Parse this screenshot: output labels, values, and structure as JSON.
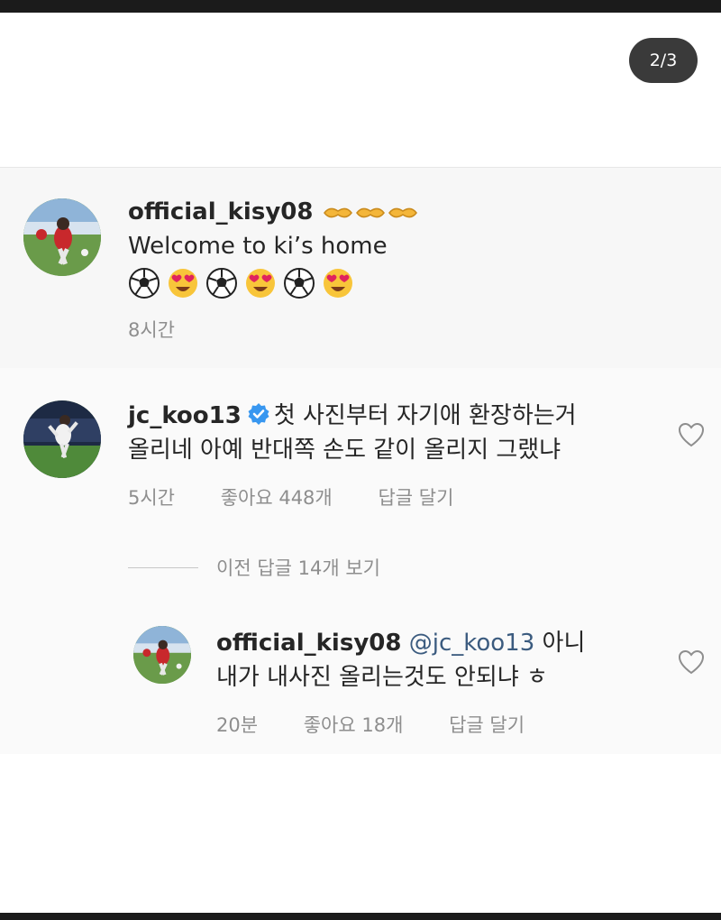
{
  "page_indicator": "2/3",
  "caption": {
    "username": "official_kisy08",
    "emojis_after_name": [
      "handshake",
      "handshake",
      "handshake"
    ],
    "text": "Welcome to ki’s home",
    "emoji_line": [
      "soccer-ball",
      "heart-eyes",
      "soccer-ball",
      "heart-eyes",
      "soccer-ball",
      "heart-eyes"
    ],
    "time": "8시간"
  },
  "comment": {
    "username": "jc_koo13",
    "verified": true,
    "text_line1": "첫 사진부터 자기애 환장하는거",
    "text_line2": "올리네 아예 반대쪽 손도 같이 올리지 그랬냐",
    "time": "5시간",
    "likes": "좋아요 448개",
    "reply": "답글 달기"
  },
  "view_replies": "이전 답글 14개 보기",
  "reply": {
    "username": "official_kisy08",
    "mention": "@jc_koo13",
    "text_line1_rest": "아니",
    "text_line2": "내가 내사진 올리는것도 안되냐 ㅎ",
    "time": "20분",
    "likes": "좋아요 18개",
    "reply": "답글 달기"
  },
  "colors": {
    "verified_blue": "#3897f0",
    "meta_gray": "#8e8e8e",
    "indicator_bg": "#3a3a3a"
  }
}
